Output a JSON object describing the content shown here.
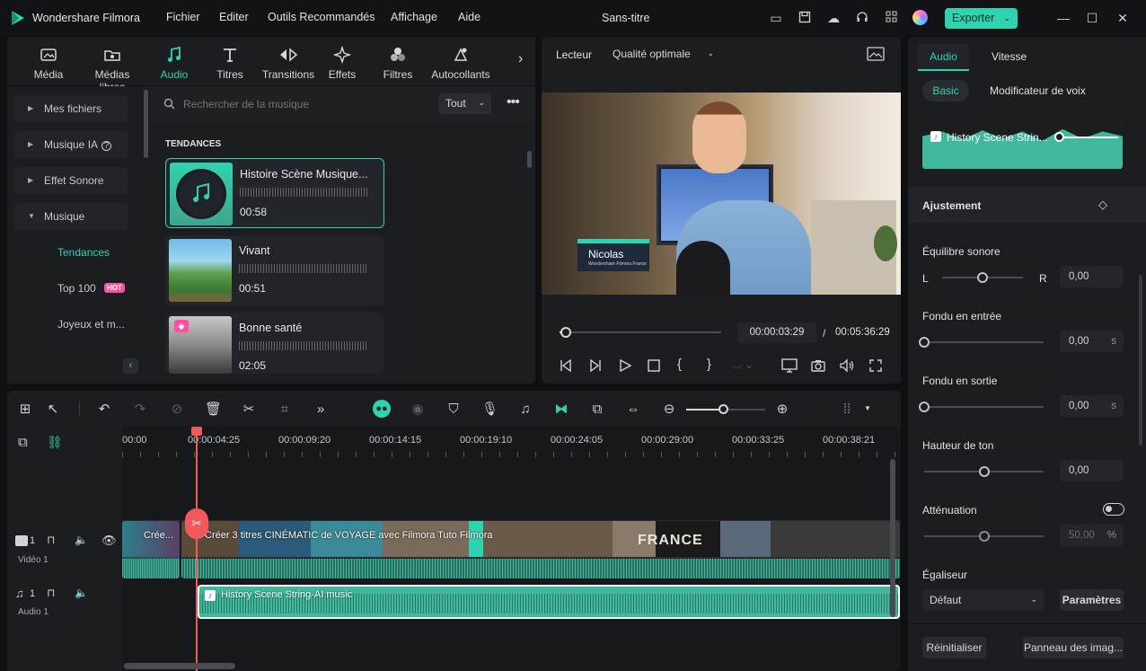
{
  "app": {
    "name": "Wondershare Filmora",
    "project_title": "Sans-titre",
    "export_label": "Exporter"
  },
  "menu": [
    "Fichier",
    "Editer",
    "Outils Recommandés",
    "Affichage",
    "Aide"
  ],
  "media_tabs": [
    {
      "label": "Média",
      "icon": "media-icon"
    },
    {
      "label": "Médias libres",
      "icon": "stock-media-icon"
    },
    {
      "label": "Audio",
      "icon": "music-note-icon"
    },
    {
      "label": "Titres",
      "icon": "text-icon"
    },
    {
      "label": "Transitions",
      "icon": "transitions-icon"
    },
    {
      "label": "Effets",
      "icon": "effects-icon"
    },
    {
      "label": "Filtres",
      "icon": "filters-icon"
    },
    {
      "label": "Autocollants",
      "icon": "stickers-icon"
    }
  ],
  "sidebar": {
    "items": [
      {
        "label": "Mes fichiers"
      },
      {
        "label": "Musique IA"
      },
      {
        "label": "Effet Sonore"
      },
      {
        "label": "Musique"
      }
    ],
    "sub_items": [
      {
        "label": "Tendances"
      },
      {
        "label": "Top 100",
        "badge": "HOT"
      },
      {
        "label": "Joyeux et m..."
      }
    ]
  },
  "search": {
    "placeholder": "Rechercher de la musique",
    "filter": "Tout"
  },
  "section_title": "TENDANCES",
  "tracks": [
    {
      "title": "Histoire Scène Musique...",
      "duration": "00:58"
    },
    {
      "title": "Vivant",
      "duration": "00:51"
    },
    {
      "title": "Bonne santé",
      "duration": "02:05"
    }
  ],
  "preview": {
    "label": "Lecteur",
    "quality": "Qualité optimale",
    "current_time": "00:00:03:29",
    "separator": "/",
    "total_time": "00:05:36:29",
    "lower_third_name": "Nicolas",
    "lower_third_sub": "Wondershare Filmora France",
    "progress": 0.01
  },
  "timeline": {
    "ruler": [
      "00:00",
      "00:00:04:25",
      "00:00:09:20",
      "00:00:14:15",
      "00:00:19:10",
      "00:00:24:05",
      "00:00:29:00",
      "00:00:33:25",
      "00:00:38:21"
    ],
    "video_track": {
      "num": "1",
      "name": "Vidéo 1",
      "clip_a": "Crée...",
      "clip_b": "Créer 3 titres CINÉMATIC de VOYAGE avec Filmora  Tuto Filmora",
      "france": "FRANCE"
    },
    "audio_track": {
      "num": "1",
      "name": "Audio 1",
      "clip": "History Scene String-AI music"
    }
  },
  "properties": {
    "tabs": [
      "Audio",
      "Vitesse"
    ],
    "subtabs": [
      "Basic",
      "Modificateur de voix"
    ],
    "clip_name": "History Scene Strin...",
    "adjust_title": "Ajustement",
    "balance": {
      "label": "Équilibre sonore",
      "left": "L",
      "right": "R",
      "value": "0,00",
      "level": 0.5
    },
    "fade_in": {
      "label": "Fondu en entrée",
      "value": "0,00",
      "unit": "s",
      "level": 0
    },
    "fade_out": {
      "label": "Fondu en sortie",
      "value": "0,00",
      "unit": "s",
      "level": 0
    },
    "pitch": {
      "label": "Hauteur de ton",
      "value": "0,00",
      "level": 0.5
    },
    "attenuation": {
      "label": "Atténuation",
      "value": "50,00",
      "unit": "%",
      "level": 0.5
    },
    "equalizer": {
      "label": "Égaliseur",
      "preset": "Défaut",
      "params": "Paramètres"
    },
    "reset": "Réinitialiser",
    "panel": "Panneau des imag..."
  },
  "colors": {
    "accent": "#2fd3b0",
    "playhead": "#f05a5a"
  }
}
